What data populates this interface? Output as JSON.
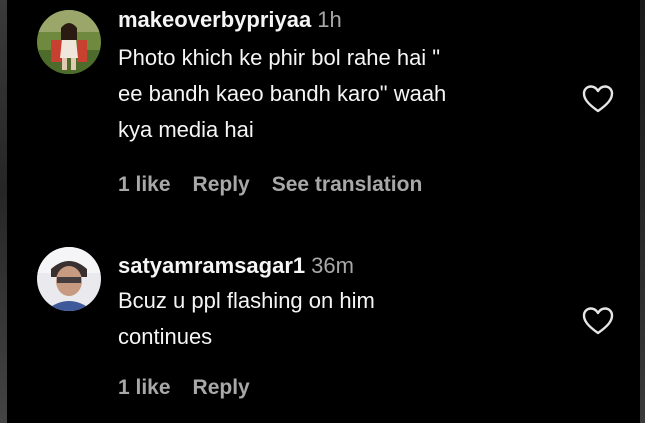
{
  "comments": [
    {
      "username": "makeoverbypriyaa",
      "time": "1h",
      "text": "Photo khich ke phir bol rahe hai \"\nee bandh kaeo bandh karo\" waah\nkya media hai",
      "likes": "1 like",
      "reply": "Reply",
      "translate": "See translation",
      "avatar_icon": "profile-photo"
    },
    {
      "username": "satyamramsagar1",
      "time": "36m",
      "text": "Bcuz u ppl flashing on him\ncontinues",
      "likes": "1 like",
      "reply": "Reply",
      "avatar_icon": "profile-photo"
    }
  ],
  "colors": {
    "background": "#000000",
    "primary_text": "#f5f5f5",
    "secondary_text": "#a8a8a8"
  }
}
